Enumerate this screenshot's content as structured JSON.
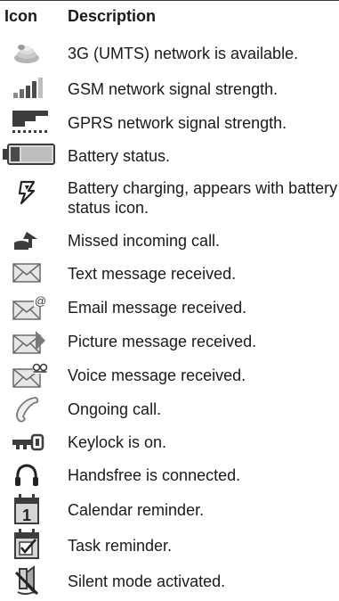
{
  "header": {
    "icon_col": "Icon",
    "desc_col": "Description"
  },
  "rows": [
    {
      "icon": "3g-network-icon",
      "description": "3G (UMTS) network is available."
    },
    {
      "icon": "gsm-signal-icon",
      "description": "GSM network signal strength."
    },
    {
      "icon": "gprs-signal-icon",
      "description": "GPRS network signal strength."
    },
    {
      "icon": "battery-icon",
      "description": "Battery status."
    },
    {
      "icon": "battery-charging-icon",
      "description": "Battery charging, appears with battery status icon."
    },
    {
      "icon": "missed-call-icon",
      "description": "Missed incoming call."
    },
    {
      "icon": "text-message-icon",
      "description": "Text message received."
    },
    {
      "icon": "email-message-icon",
      "description": "Email message received."
    },
    {
      "icon": "picture-message-icon",
      "description": "Picture message received."
    },
    {
      "icon": "voice-message-icon",
      "description": "Voice message received."
    },
    {
      "icon": "ongoing-call-icon",
      "description": "Ongoing call."
    },
    {
      "icon": "keylock-icon",
      "description": "Keylock is on."
    },
    {
      "icon": "handsfree-icon",
      "description": "Handsfree is connected."
    },
    {
      "icon": "calendar-reminder-icon",
      "description": "Calendar reminder."
    },
    {
      "icon": "task-reminder-icon",
      "description": "Task reminder."
    },
    {
      "icon": "silent-mode-icon",
      "description": "Silent mode activated."
    }
  ],
  "colors": {
    "text": "#1a1a1a",
    "icon_gray": "#8a8a8a",
    "icon_dark": "#3c3c3c"
  }
}
